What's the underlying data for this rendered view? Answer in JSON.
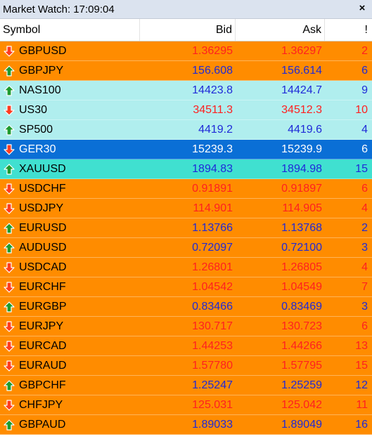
{
  "title": "Market Watch: 17:09:04",
  "close_label": "×",
  "headers": {
    "symbol": "Symbol",
    "bid": "Bid",
    "ask": "Ask",
    "spread": "!"
  },
  "colors": {
    "orange_bg": "#ff8c00",
    "light_cyan_bg": "#b0eeee",
    "selected_bg": "#0a6fd6",
    "turquoise_bg": "#40e0d0",
    "down_text": "#ff2020",
    "up_text": "#1f2ad8",
    "selected_text": "#ffffff",
    "up_arrow": "#1e9b2e",
    "down_arrow": "#ff3b1f"
  },
  "rows": [
    {
      "symbol": "GBPUSD",
      "bid": "1.36295",
      "ask": "1.36297",
      "spread": "2",
      "direction": "down",
      "style": "orange"
    },
    {
      "symbol": "GBPJPY",
      "bid": "156.608",
      "ask": "156.614",
      "spread": "6",
      "direction": "up",
      "style": "orange"
    },
    {
      "symbol": "NAS100",
      "bid": "14423.8",
      "ask": "14424.7",
      "spread": "9",
      "direction": "up",
      "style": "cyan"
    },
    {
      "symbol": "US30",
      "bid": "34511.3",
      "ask": "34512.3",
      "spread": "10",
      "direction": "down",
      "style": "cyan"
    },
    {
      "symbol": "SP500",
      "bid": "4419.2",
      "ask": "4419.6",
      "spread": "4",
      "direction": "up",
      "style": "cyan"
    },
    {
      "symbol": "GER30",
      "bid": "15239.3",
      "ask": "15239.9",
      "spread": "6",
      "direction": "down",
      "style": "selected"
    },
    {
      "symbol": "XAUUSD",
      "bid": "1894.83",
      "ask": "1894.98",
      "spread": "15",
      "direction": "up",
      "style": "turquoise"
    },
    {
      "symbol": "USDCHF",
      "bid": "0.91891",
      "ask": "0.91897",
      "spread": "6",
      "direction": "down",
      "style": "orange"
    },
    {
      "symbol": "USDJPY",
      "bid": "114.901",
      "ask": "114.905",
      "spread": "4",
      "direction": "down",
      "style": "orange"
    },
    {
      "symbol": "EURUSD",
      "bid": "1.13766",
      "ask": "1.13768",
      "spread": "2",
      "direction": "up",
      "style": "orange"
    },
    {
      "symbol": "AUDUSD",
      "bid": "0.72097",
      "ask": "0.72100",
      "spread": "3",
      "direction": "up",
      "style": "orange"
    },
    {
      "symbol": "USDCAD",
      "bid": "1.26801",
      "ask": "1.26805",
      "spread": "4",
      "direction": "down",
      "style": "orange"
    },
    {
      "symbol": "EURCHF",
      "bid": "1.04542",
      "ask": "1.04549",
      "spread": "7",
      "direction": "down",
      "style": "orange"
    },
    {
      "symbol": "EURGBP",
      "bid": "0.83466",
      "ask": "0.83469",
      "spread": "3",
      "direction": "up",
      "style": "orange"
    },
    {
      "symbol": "EURJPY",
      "bid": "130.717",
      "ask": "130.723",
      "spread": "6",
      "direction": "down",
      "style": "orange"
    },
    {
      "symbol": "EURCAD",
      "bid": "1.44253",
      "ask": "1.44266",
      "spread": "13",
      "direction": "down",
      "style": "orange"
    },
    {
      "symbol": "EURAUD",
      "bid": "1.57780",
      "ask": "1.57795",
      "spread": "15",
      "direction": "down",
      "style": "orange"
    },
    {
      "symbol": "GBPCHF",
      "bid": "1.25247",
      "ask": "1.25259",
      "spread": "12",
      "direction": "up",
      "style": "orange"
    },
    {
      "symbol": "CHFJPY",
      "bid": "125.031",
      "ask": "125.042",
      "spread": "11",
      "direction": "down",
      "style": "orange"
    },
    {
      "symbol": "GBPAUD",
      "bid": "1.89033",
      "ask": "1.89049",
      "spread": "16",
      "direction": "up",
      "style": "orange"
    }
  ]
}
